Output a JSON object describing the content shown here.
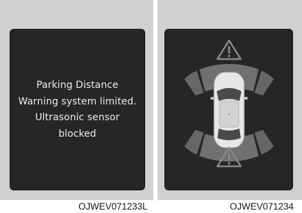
{
  "left_display": {
    "message_lines": [
      "Parking Distance",
      "Warning system limited.",
      "Ultrasonic sensor",
      "blocked"
    ],
    "caption": "OJWEV071233L"
  },
  "right_display": {
    "caption": "OJWEV071234",
    "icons": [
      "front-warning-triangle-icon",
      "rear-warning-triangle-icon",
      "car-top-view-icon"
    ]
  },
  "colors": {
    "screen": "#262626",
    "panel": "#d0d0d0",
    "sensor_zone": "#707070",
    "warning_triangle": "#8a8a8a",
    "text": "#ececec"
  }
}
